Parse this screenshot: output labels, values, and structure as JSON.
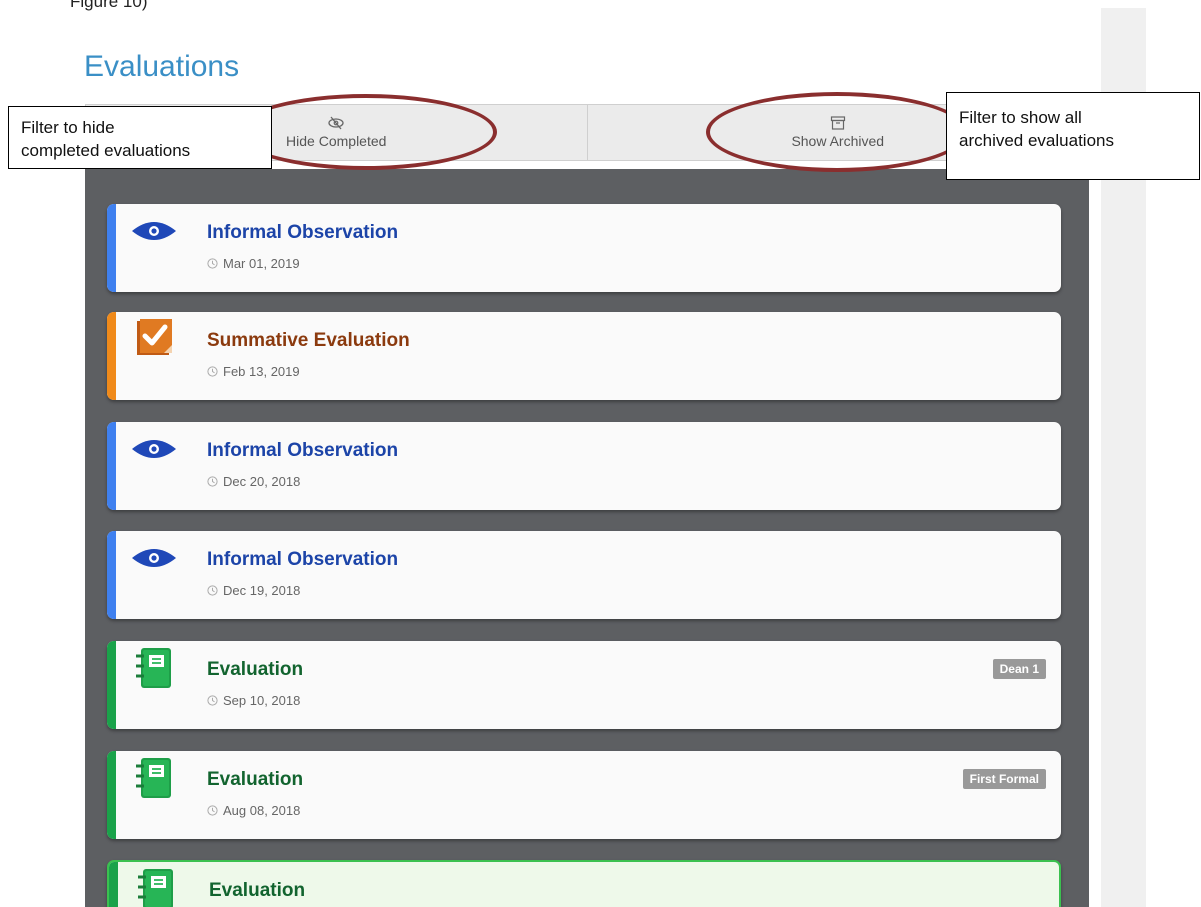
{
  "document": {
    "caption": "Figure 10)"
  },
  "page": {
    "title": "Evaluations"
  },
  "filters": {
    "hide_completed": "Hide Completed",
    "show_archived": "Show Archived"
  },
  "callouts": {
    "left_line1": "Filter to hide",
    "left_line2": "completed evaluations",
    "right_line1": "Filter to show all",
    "right_line2": "archived evaluations"
  },
  "evaluations": [
    {
      "title": "Informal Observation",
      "date": "Mar 01, 2019",
      "icon": "eye-icon",
      "color": "#1c44a8",
      "stripe": "#3f80ef",
      "badge": ""
    },
    {
      "title": "Summative Evaluation",
      "date": "Feb 13, 2019",
      "icon": "checklist-icon",
      "color": "#8b3a0e",
      "stripe": "#f08a1a",
      "badge": ""
    },
    {
      "title": "Informal Observation",
      "date": "Dec 20, 2018",
      "icon": "eye-icon",
      "color": "#1c44a8",
      "stripe": "#3f80ef",
      "badge": ""
    },
    {
      "title": "Informal Observation",
      "date": "Dec 19, 2018",
      "icon": "eye-icon",
      "color": "#1c44a8",
      "stripe": "#3f80ef",
      "badge": ""
    },
    {
      "title": "Evaluation",
      "date": "Sep 10, 2018",
      "icon": "notebook-icon",
      "color": "#12642f",
      "stripe": "#1aa24a",
      "badge": "Dean 1"
    },
    {
      "title": "Evaluation",
      "date": "Aug 08, 2018",
      "icon": "notebook-icon",
      "color": "#12642f",
      "stripe": "#1aa24a",
      "badge": "First Formal"
    },
    {
      "title": "Evaluation",
      "date": "",
      "icon": "notebook-icon",
      "color": "#12642f",
      "stripe": "#1aa24a",
      "badge": ""
    }
  ]
}
